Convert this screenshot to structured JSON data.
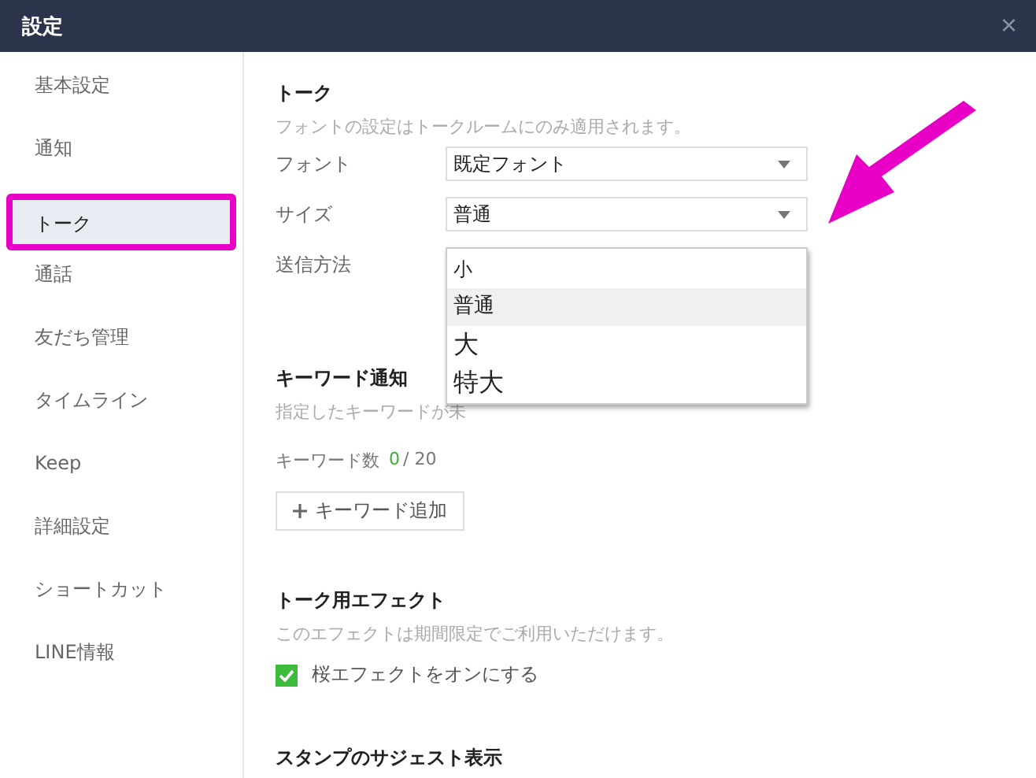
{
  "window": {
    "title": "設定",
    "close": "×"
  },
  "sidebar": {
    "items": [
      {
        "label": "基本設定",
        "selected": false,
        "highlighted": false
      },
      {
        "label": "通知",
        "selected": false,
        "highlighted": false
      },
      {
        "label": "トーク",
        "selected": true,
        "highlighted": true
      },
      {
        "label": "通話",
        "selected": false,
        "highlighted": false
      },
      {
        "label": "友だち管理",
        "selected": false,
        "highlighted": false
      },
      {
        "label": "タイムライン",
        "selected": false,
        "highlighted": false
      },
      {
        "label": "Keep",
        "selected": false,
        "highlighted": false
      },
      {
        "label": "詳細設定",
        "selected": false,
        "highlighted": false
      },
      {
        "label": "ショートカット",
        "selected": false,
        "highlighted": false
      },
      {
        "label": "LINE情報",
        "selected": false,
        "highlighted": false
      }
    ]
  },
  "talk": {
    "title": "トーク",
    "description": "フォントの設定はトークルームにのみ適用されます。",
    "fields": [
      {
        "label": "フォント",
        "value": "既定フォント"
      },
      {
        "label": "サイズ",
        "value": "普通"
      },
      {
        "label": "送信方法"
      }
    ],
    "size_dropdown": {
      "options": [
        {
          "label": "小",
          "selected": false
        },
        {
          "label": "普通",
          "selected": true
        },
        {
          "label": "大",
          "selected": false
        },
        {
          "label": "特大",
          "selected": false
        }
      ]
    }
  },
  "keyword": {
    "title": "キーワード通知",
    "description": "指定したキーワードが未",
    "count_label": "キーワード数",
    "count": "0",
    "limit": "/ 20",
    "add_button": "キーワード追加"
  },
  "effect": {
    "title": "トーク用エフェクト",
    "description": "このエフェクトは期間限定でご利用いただけます。",
    "checkbox": {
      "label": "桜エフェクトをオンにする",
      "checked": true
    }
  },
  "stamp": {
    "title": "スタンプのサジェスト表示"
  }
}
